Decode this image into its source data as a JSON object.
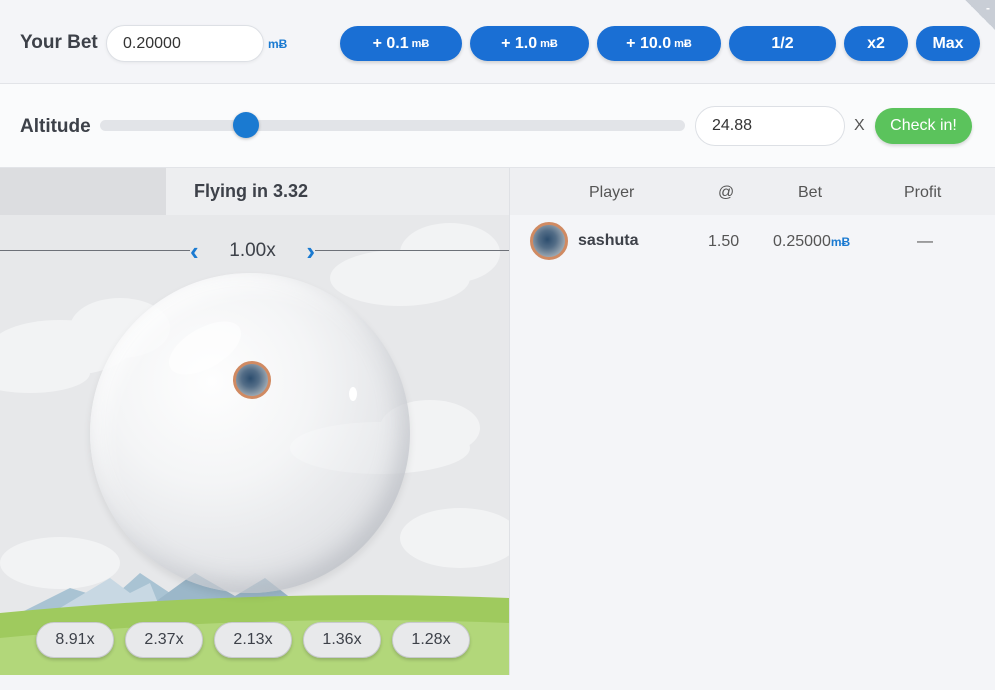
{
  "bet": {
    "label": "Your Bet",
    "value": "0.20000",
    "unit": "mɃ",
    "buttons": [
      {
        "label": "+ 0.1",
        "unit": "mɃ"
      },
      {
        "label": "+ 1.0",
        "unit": "mɃ"
      },
      {
        "label": "+ 10.0",
        "unit": "mɃ"
      },
      {
        "label": "1/2",
        "unit": ""
      },
      {
        "label": "x2",
        "unit": ""
      },
      {
        "label": "Max",
        "unit": ""
      }
    ],
    "corner_label": "-"
  },
  "altitude": {
    "label": "Altitude",
    "slider_fraction": 0.25,
    "value": "24.88",
    "x_label": "X",
    "checkin_label": "Check in!"
  },
  "game": {
    "status": "Flying in 3.32",
    "multiplier": "1.00x",
    "chips": [
      "8.91x",
      "2.37x",
      "2.13x",
      "1.36x",
      "1.28x"
    ]
  },
  "players": {
    "headers": {
      "player": "Player",
      "at": "@",
      "bet": "Bet",
      "profit": "Profit"
    },
    "rows": [
      {
        "name": "sashuta",
        "at": "1.50",
        "bet": "0.25000",
        "bet_unit": "mɃ",
        "profit": "—"
      }
    ]
  },
  "colors": {
    "accent": "#1a6fd4",
    "green": "#5bc35c"
  }
}
